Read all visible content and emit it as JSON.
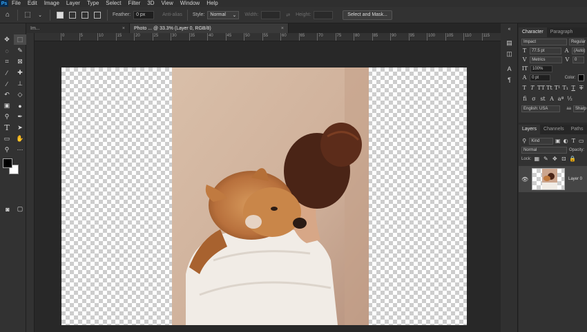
{
  "menubar": {
    "logo": "Ps",
    "items": [
      "File",
      "Edit",
      "Image",
      "Layer",
      "Type",
      "Select",
      "Filter",
      "3D",
      "View",
      "Window",
      "Help"
    ]
  },
  "options": {
    "feather_label": "Feather:",
    "feather_value": "0 px",
    "antialias_label": "Anti-alias",
    "style_label": "Style:",
    "style_value": "Normal",
    "width_label": "Width:",
    "height_label": "Height:",
    "select_mask_label": "Select and Mask..."
  },
  "tabs": [
    {
      "label": "Im...",
      "active": false
    },
    {
      "label": "Photo ... @ 33.3% (Layer 0, RGB/8)",
      "active": true
    }
  ],
  "ruler": {
    "top_ticks": [
      "0",
      "5",
      "10",
      "15",
      "20",
      "25",
      "30",
      "35",
      "40",
      "45",
      "50",
      "55",
      "60",
      "65",
      "70",
      "75",
      "80",
      "85",
      "90",
      "95",
      "100",
      "105",
      "110",
      "115"
    ]
  },
  "character_panel": {
    "tabs": [
      "Character",
      "Paragraph"
    ],
    "font_family": "Impact",
    "font_style": "Regular",
    "font_size": "77.5 pt",
    "leading": "(Auto)",
    "kerning": "Metrics",
    "tracking": "0",
    "vertical_scale": "100%",
    "baseline_shift": "0 pt",
    "color_label": "Color:",
    "language": "English: USA",
    "antialias": "Sharp"
  },
  "layers_panel": {
    "tabs": [
      "Layers",
      "Channels",
      "Paths"
    ],
    "filter_kind": "Kind",
    "blend_mode": "Normal",
    "opacity_label": "Opacity:",
    "lock_label": "Lock:",
    "layers": [
      {
        "name": "Layer 0",
        "visible": true
      }
    ]
  }
}
